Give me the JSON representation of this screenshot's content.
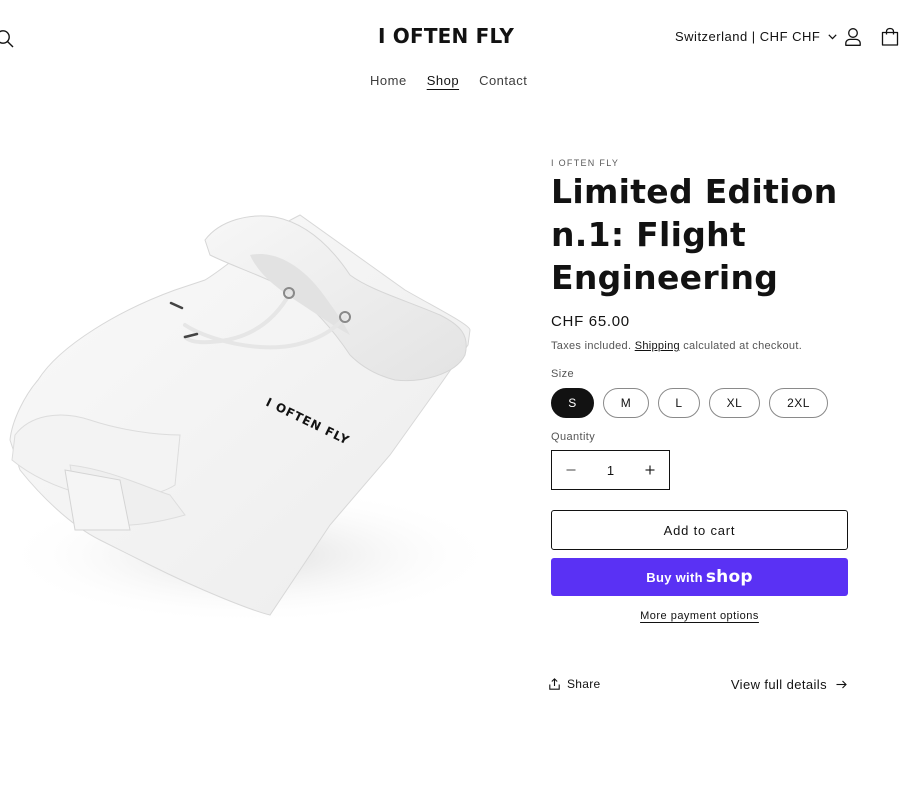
{
  "header": {
    "logo": "I OFTEN FLY",
    "locale": "Switzerland | CHF CHF",
    "icons": {
      "search": "search-icon",
      "account": "user-icon",
      "cart": "cart-icon",
      "locale_caret": "chevron-down-icon"
    }
  },
  "nav": {
    "items": [
      {
        "label": "Home",
        "active": false
      },
      {
        "label": "Shop",
        "active": true
      },
      {
        "label": "Contact",
        "active": false
      }
    ]
  },
  "product": {
    "vendor": "I OFTEN FLY",
    "title": "Limited Edition n.1: Flight Engineering",
    "price": "CHF 65.00",
    "tax_prefix": "Taxes included. ",
    "tax_link": "Shipping",
    "tax_suffix": " calculated at checkout.",
    "image_print": "I OFTEN FLY",
    "size_label": "Size",
    "sizes": [
      "S",
      "M",
      "L",
      "XL",
      "2XL"
    ],
    "selected_size": "S",
    "quantity_label": "Quantity",
    "quantity": "1",
    "add_to_cart": "Add to cart",
    "buy_with": "Buy with",
    "shop_word": "shop",
    "more_payment": "More payment options",
    "share": "Share",
    "view_full": "View full details"
  },
  "colors": {
    "accent": "#5a31f4",
    "text": "#121212",
    "selected": "#121212"
  }
}
